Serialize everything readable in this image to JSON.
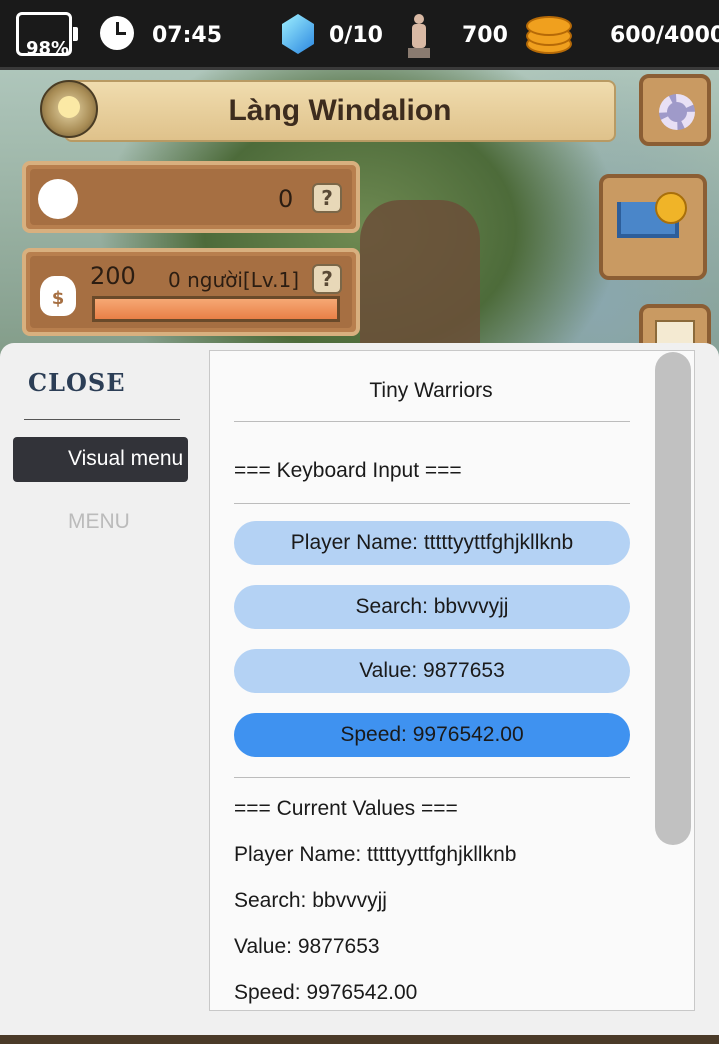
{
  "hud": {
    "battery": "98%",
    "time": "07:45",
    "gems": "0/10",
    "statue_count": "700",
    "gold": "600/4000"
  },
  "header": {
    "village_title": "Làng Windalion"
  },
  "panels": {
    "rank_value": "0",
    "rank_help": "?",
    "money_value": "200",
    "population": "0 người[Lv.1]",
    "money_help": "?",
    "money_icon_symbol": "$",
    "progress_fraction": 1.0
  },
  "side_menu": {
    "close_label": "CLOSE",
    "active_item": "Visual menu",
    "item_menu": "MENU"
  },
  "content": {
    "title": "Tiny Warriors",
    "keyboard_header": "=== Keyboard Input ===",
    "fields": [
      {
        "label": "Player Name: tttttyyttfghjkllknb"
      },
      {
        "label": "Search: bbvvvyjj"
      },
      {
        "label": "Value: 9877653"
      },
      {
        "label": "Speed: 9976542.00"
      }
    ],
    "current_header": "=== Current Values ===",
    "current": [
      "Player Name: tttttyyttfghjkllknb",
      "Search: bbvvvyjj",
      "Value: 9877653",
      "Speed: 9976542.00"
    ]
  },
  "colors": {
    "pill": "#b4d2f4",
    "pill_active": "#3f92f0",
    "nav_active_bg": "#323339"
  }
}
